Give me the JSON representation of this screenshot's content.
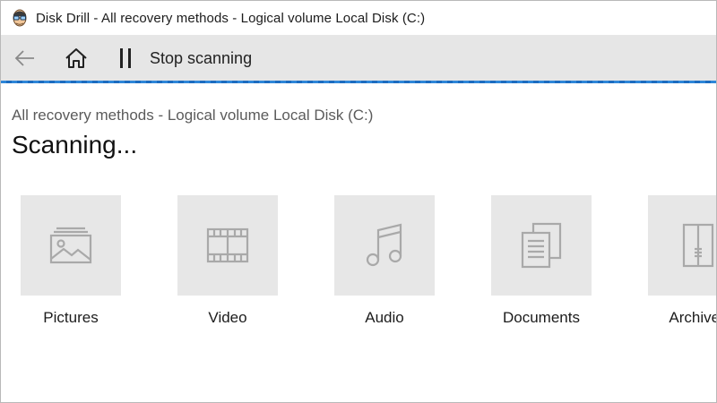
{
  "window": {
    "title": "Disk Drill - All recovery methods - Logical volume Local Disk (C:)"
  },
  "toolbar": {
    "back_icon": "arrow-left-icon",
    "home_icon": "home-icon",
    "pause_icon": "pause-icon",
    "stop_label": "Stop scanning"
  },
  "main": {
    "subtitle": "All recovery methods - Logical volume Local Disk (C:)",
    "heading": "Scanning..."
  },
  "categories": [
    {
      "label": "Pictures",
      "icon": "picture-icon"
    },
    {
      "label": "Video",
      "icon": "film-icon"
    },
    {
      "label": "Audio",
      "icon": "music-note-icon"
    },
    {
      "label": "Documents",
      "icon": "documents-icon"
    },
    {
      "label": "Archives",
      "icon": "archive-icon"
    }
  ],
  "colors": {
    "accent": "#2e86d8",
    "toolbar_bg": "#e6e6e6",
    "tile_bg": "#e7e7e7",
    "icon_gray": "#a9a9a9"
  }
}
